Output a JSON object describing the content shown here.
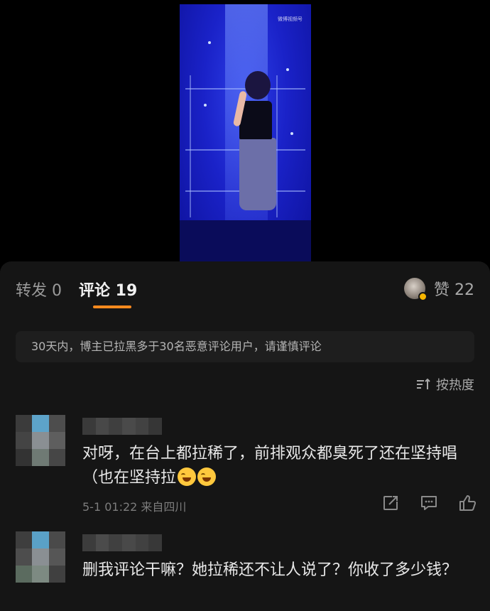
{
  "video": {
    "watermark": "微博视频号"
  },
  "tabs": [
    {
      "label": "转发 0"
    },
    {
      "label": "评论 19"
    }
  ],
  "likes": {
    "label": "赞 22"
  },
  "notice": "30天内，博主已拉黑多于30名恶意评论用户，请谨慎评论",
  "sort": {
    "label": "按热度"
  },
  "comments": [
    {
      "text": "对呀，在台上都拉稀了，前排观众都臭死了还在坚持唱（也在坚持拉",
      "emojis": [
        "crying-laugh-emoji",
        "crying-laugh-emoji"
      ],
      "meta": "5-1 01:22  来自四川"
    },
    {
      "text": "删我评论干嘛？她拉稀还不让人说了？你收了多少钱？"
    }
  ],
  "colors": {
    "accent": "#ff8a1e",
    "sheet": "#151515",
    "notice_bg": "#1e1e1e"
  }
}
